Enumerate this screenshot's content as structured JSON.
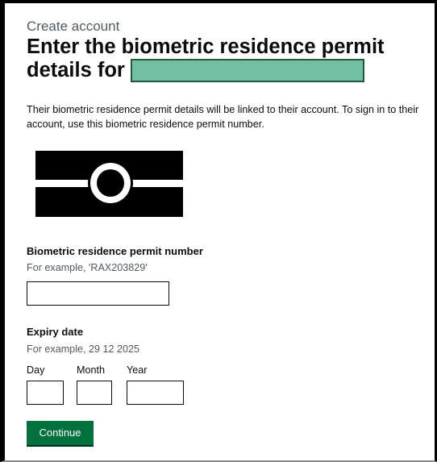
{
  "header": {
    "caption": "Create account",
    "heading": "Enter the biometric residence permit details for"
  },
  "intro": "Their biometric residence permit details will be linked to their account. To sign in to their account, use this biometric residence permit number.",
  "brp_number": {
    "label": "Biometric residence permit number",
    "hint": "For example, 'RAX203829'",
    "value": ""
  },
  "expiry_date": {
    "label": "Expiry date",
    "hint": "For example, 29 12 2025",
    "day_label": "Day",
    "month_label": "Month",
    "year_label": "Year"
  },
  "continue_label": "Continue",
  "colors": {
    "button": "#00703c",
    "redaction": "#74bfa2"
  },
  "icons": [
    "biometric-chip-logo-icon"
  ]
}
